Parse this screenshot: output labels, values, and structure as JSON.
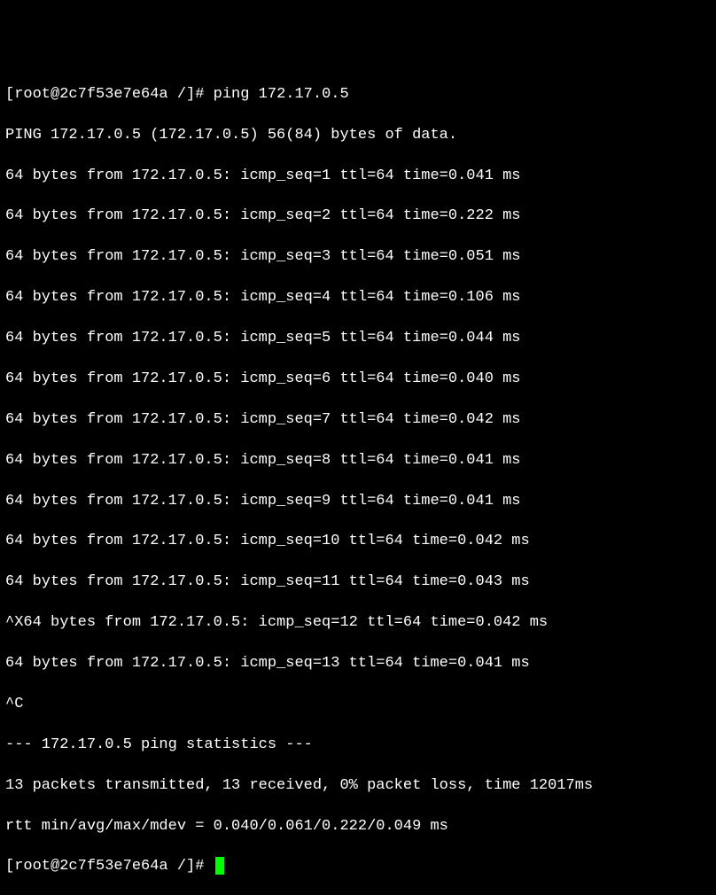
{
  "prompt1": {
    "user": "root",
    "host": "2c7f53e7e64a",
    "path": "/",
    "symbol": "#",
    "command": "ping 172.17.0.5"
  },
  "ping_header": "PING 172.17.0.5 (172.17.0.5) 56(84) bytes of data.",
  "replies": [
    "64 bytes from 172.17.0.5: icmp_seq=1 ttl=64 time=0.041 ms",
    "64 bytes from 172.17.0.5: icmp_seq=2 ttl=64 time=0.222 ms",
    "64 bytes from 172.17.0.5: icmp_seq=3 ttl=64 time=0.051 ms",
    "64 bytes from 172.17.0.5: icmp_seq=4 ttl=64 time=0.106 ms",
    "64 bytes from 172.17.0.5: icmp_seq=5 ttl=64 time=0.044 ms",
    "64 bytes from 172.17.0.5: icmp_seq=6 ttl=64 time=0.040 ms",
    "64 bytes from 172.17.0.5: icmp_seq=7 ttl=64 time=0.042 ms",
    "64 bytes from 172.17.0.5: icmp_seq=8 ttl=64 time=0.041 ms",
    "64 bytes from 172.17.0.5: icmp_seq=9 ttl=64 time=0.041 ms",
    "64 bytes from 172.17.0.5: icmp_seq=10 ttl=64 time=0.042 ms",
    "64 bytes from 172.17.0.5: icmp_seq=11 ttl=64 time=0.043 ms",
    "^X64 bytes from 172.17.0.5: icmp_seq=12 ttl=64 time=0.042 ms",
    "64 bytes from 172.17.0.5: icmp_seq=13 ttl=64 time=0.041 ms"
  ],
  "interrupt": "^C",
  "stats_header": "--- 172.17.0.5 ping statistics ---",
  "stats_line1": "13 packets transmitted, 13 received, 0% packet loss, time 12017ms",
  "stats_line2": "rtt min/avg/max/mdev = 0.040/0.061/0.222/0.049 ms",
  "prompt2": {
    "user": "root",
    "host": "2c7f53e7e64a",
    "path": "/",
    "symbol": "#"
  }
}
